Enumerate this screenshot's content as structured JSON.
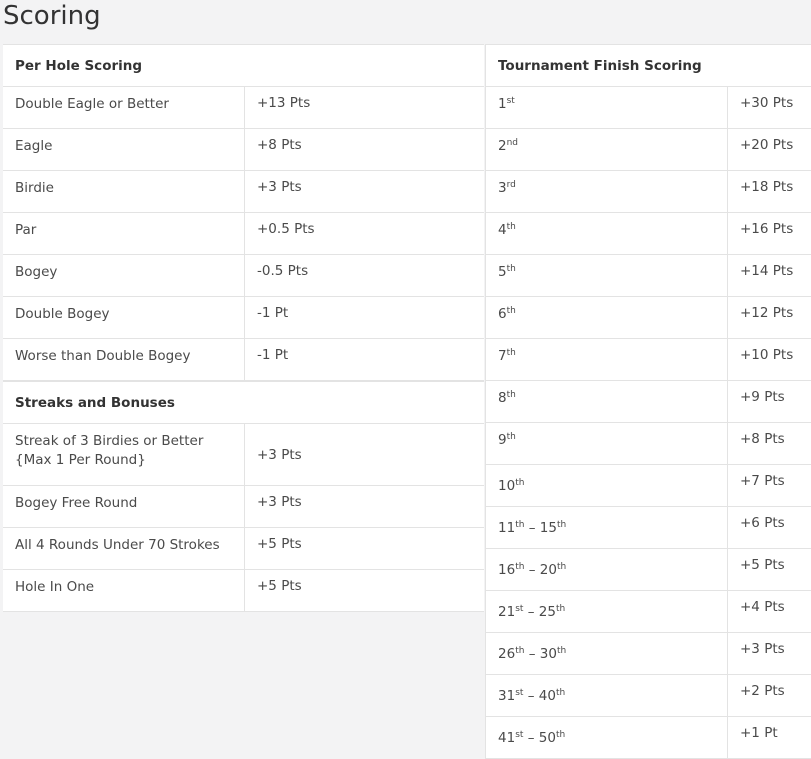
{
  "page": {
    "title": "Scoring"
  },
  "per_hole": {
    "header": "Per Hole Scoring",
    "rows": [
      {
        "label": "Double Eagle or Better",
        "pts": "+13 Pts"
      },
      {
        "label": "Eagle",
        "pts": "+8 Pts"
      },
      {
        "label": "Birdie",
        "pts": "+3 Pts"
      },
      {
        "label": "Par",
        "pts": "+0.5 Pts"
      },
      {
        "label": "Bogey",
        "pts": "-0.5 Pts"
      },
      {
        "label": "Double Bogey",
        "pts": "-1 Pt"
      },
      {
        "label": "Worse than Double Bogey",
        "pts": "-1 Pt"
      }
    ]
  },
  "streaks": {
    "header": "Streaks and Bonuses",
    "rows": [
      {
        "label_line1": "Streak of 3 Birdies or Better",
        "label_line2": "{Max 1 Per Round}",
        "pts": "+3 Pts"
      },
      {
        "label": "Bogey Free Round",
        "pts": "+3 Pts"
      },
      {
        "label": "All 4 Rounds Under 70 Strokes",
        "pts": "+5 Pts"
      },
      {
        "label": "Hole In One",
        "pts": "+5 Pts"
      }
    ]
  },
  "tournament": {
    "header": "Tournament Finish Scoring",
    "rows": [
      {
        "a": "1",
        "a_sup": "st",
        "pts": "+30 Pts"
      },
      {
        "a": "2",
        "a_sup": "nd",
        "pts": "+20 Pts"
      },
      {
        "a": "3",
        "a_sup": "rd",
        "pts": "+18 Pts"
      },
      {
        "a": "4",
        "a_sup": "th",
        "pts": "+16 Pts"
      },
      {
        "a": "5",
        "a_sup": "th",
        "pts": "+14 Pts"
      },
      {
        "a": "6",
        "a_sup": "th",
        "pts": "+12 Pts"
      },
      {
        "a": "7",
        "a_sup": "th",
        "pts": "+10 Pts"
      },
      {
        "a": "8",
        "a_sup": "th",
        "pts": "+9 Pts"
      },
      {
        "a": "9",
        "a_sup": "th",
        "pts": "+8 Pts"
      },
      {
        "a": "10",
        "a_sup": "th",
        "pts": "+7 Pts"
      },
      {
        "a": "11",
        "a_sup": "th",
        "sep": " – ",
        "b": "15",
        "b_sup": "th",
        "pts": "+6 Pts"
      },
      {
        "a": "16",
        "a_sup": "th",
        "sep": " – ",
        "b": "20",
        "b_sup": "th",
        "pts": "+5 Pts"
      },
      {
        "a": "21",
        "a_sup": "st",
        "sep": " – ",
        "b": "25",
        "b_sup": "th",
        "pts": "+4 Pts"
      },
      {
        "a": "26",
        "a_sup": "th",
        "sep": " – ",
        "b": "30",
        "b_sup": "th",
        "pts": "+3 Pts"
      },
      {
        "a": "31",
        "a_sup": "st",
        "sep": " – ",
        "b": "40",
        "b_sup": "th",
        "pts": "+2 Pts"
      },
      {
        "a": "41",
        "a_sup": "st",
        "sep": " – ",
        "b": "50",
        "b_sup": "th",
        "pts": "+1 Pt"
      }
    ]
  }
}
